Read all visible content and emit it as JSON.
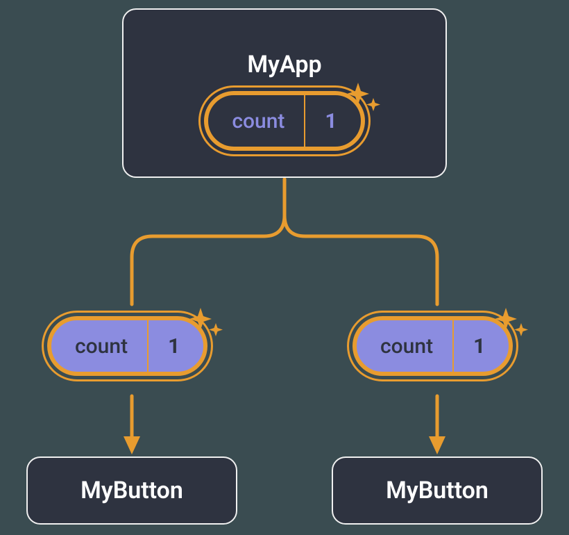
{
  "colors": {
    "background": "#3a4c51",
    "node_bg": "#2e3340",
    "node_border": "#f0f0f0",
    "accent": "#e89c2f",
    "pill_light": "#8b8ce0",
    "text_light": "#ffffff"
  },
  "parent": {
    "title": "MyApp",
    "state_label": "count",
    "state_value": "1"
  },
  "children": [
    {
      "prop_label": "count",
      "prop_value": "1",
      "node_title": "MyButton"
    },
    {
      "prop_label": "count",
      "prop_value": "1",
      "node_title": "MyButton"
    }
  ]
}
